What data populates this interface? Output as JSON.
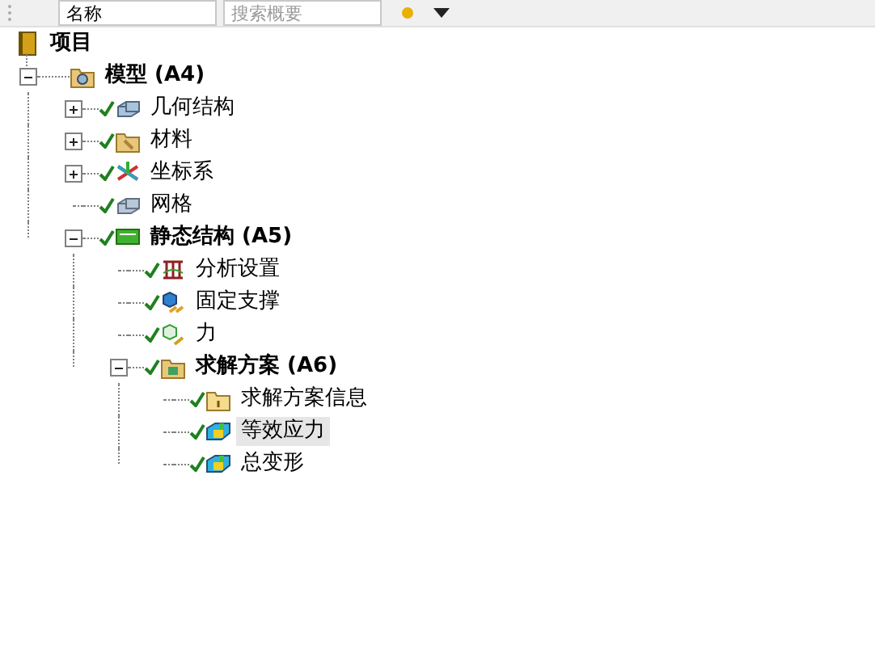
{
  "toolbar": {
    "name_field": {
      "value": "名称"
    },
    "search": {
      "placeholder": "搜索概要"
    }
  },
  "tree": {
    "label": "项目",
    "kind": "project",
    "children": [
      {
        "label": "模型 (A4)",
        "kind": "model",
        "expanded": true,
        "checked": false,
        "selected": false,
        "children": [
          {
            "label": "几何结构",
            "kind": "geometry",
            "expanded": false,
            "checked": true,
            "selected": false
          },
          {
            "label": "材料",
            "kind": "material",
            "expanded": false,
            "checked": true,
            "selected": false
          },
          {
            "label": "坐标系",
            "kind": "coords",
            "expanded": false,
            "checked": true,
            "selected": false
          },
          {
            "label": "网格",
            "kind": "mesh",
            "checked": true,
            "selected": false
          },
          {
            "label": "静态结构 (A5)",
            "kind": "analysis",
            "expanded": true,
            "checked": true,
            "selected": false,
            "children": [
              {
                "label": "分析设置",
                "kind": "settings",
                "checked": true,
                "selected": false
              },
              {
                "label": "固定支撑",
                "kind": "support",
                "checked": true,
                "selected": false
              },
              {
                "label": "力",
                "kind": "force",
                "checked": true,
                "selected": false
              },
              {
                "label": "求解方案 (A6)",
                "kind": "solution",
                "expanded": true,
                "checked": true,
                "selected": false,
                "children": [
                  {
                    "label": "求解方案信息",
                    "kind": "info",
                    "checked": true,
                    "selected": false
                  },
                  {
                    "label": "等效应力",
                    "kind": "result",
                    "checked": true,
                    "selected": true
                  },
                  {
                    "label": "总变形",
                    "kind": "result",
                    "checked": true,
                    "selected": false
                  }
                ]
              }
            ]
          }
        ]
      }
    ]
  }
}
